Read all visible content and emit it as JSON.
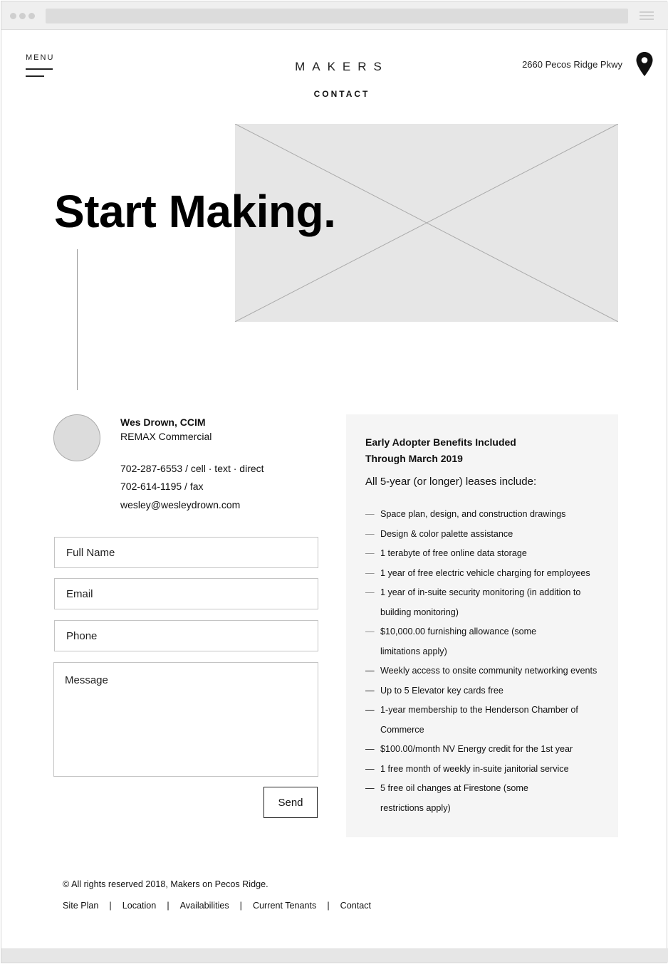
{
  "header": {
    "menu_label": "MENU",
    "brand": "MAKERS",
    "page_title": "CONTACT",
    "address": "2660 Pecos Ridge Pkwy"
  },
  "hero": {
    "title": "Start Making."
  },
  "contact": {
    "name": "Wes Drown, CCIM",
    "company": "REMAX Commercial",
    "cell": "702-287-6553 / cell · text · direct",
    "fax": "702-614-1195 / fax",
    "email": "wesley@wesleydrown.com"
  },
  "form": {
    "full_name_placeholder": "Full Name",
    "email_placeholder": "Email",
    "phone_placeholder": "Phone",
    "message_placeholder": "Message",
    "send_label": "Send"
  },
  "benefits": {
    "title_line1": "Early Adopter Benefits Included",
    "title_line2": "Through March 2019",
    "intro": "All 5-year (or longer) leases include:",
    "dash": "—",
    "items": [
      {
        "line1": "Space plan, design, and construction drawings",
        "line2": ""
      },
      {
        "line1": "Design & color palette assistance",
        "line2": ""
      },
      {
        "line1": "1 terabyte of free online data storage",
        "line2": ""
      },
      {
        "line1": "1 year of free electric vehicle charging for employees",
        "line2": ""
      },
      {
        "line1": "1 year of in-suite security monitoring (in addition to",
        "line2": "building monitoring)"
      },
      {
        "line1": "$10,000.00 furnishing allowance (some",
        "line2": "limitations apply)"
      },
      {
        "line1": "Weekly access to onsite community networking events",
        "line2": ""
      },
      {
        "line1": "Up to 5 Elevator key cards free",
        "line2": ""
      },
      {
        "line1": "1-year membership to the Henderson Chamber of",
        "line2": "Commerce"
      },
      {
        "line1": "$100.00/month NV Energy credit for the 1st year",
        "line2": ""
      },
      {
        "line1": "1 free month of weekly in-suite janitorial service",
        "line2": ""
      },
      {
        "line1": "5 free oil changes at Firestone (some",
        "line2": "restrictions apply)"
      }
    ]
  },
  "footer": {
    "copyright": "© All rights reserved 2018, Makers on Pecos Ridge.",
    "separator": "|",
    "links": [
      "Site Plan",
      "Location",
      "Availabilities",
      "Current Tenants",
      "Contact"
    ]
  }
}
